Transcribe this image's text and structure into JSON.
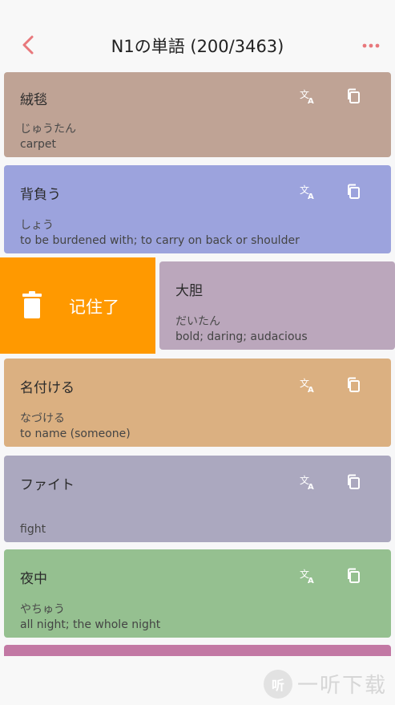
{
  "header": {
    "title": "N1の単語 (200/3463)",
    "back_icon": "chevron-left-icon",
    "more_icon": "more-dots-icon",
    "accent": "#e8787c"
  },
  "cards": [
    {
      "word": "絨毯",
      "reading": "じゅうたん",
      "meaning": "carpet",
      "color": "#bfa395"
    },
    {
      "word": "背負う",
      "reading": "しょう",
      "meaning": "to be burdened with; to carry on back or shoulder",
      "color": "#9ca3dd"
    },
    {
      "word": "大胆",
      "reading": "だいたん",
      "meaning": "bold; daring; audacious",
      "color": "#bba7bc"
    },
    {
      "word": "名付ける",
      "reading": "なづける",
      "meaning": "to name (someone)",
      "color": "#dbb081"
    },
    {
      "word": "ファイト",
      "reading": "",
      "meaning": "fight",
      "color": "#aba8bf"
    },
    {
      "word": "夜中",
      "reading": "やちゅう",
      "meaning": "all night; the whole night",
      "color": "#95c090"
    },
    {
      "color": "#c278a4"
    }
  ],
  "swipe_action": {
    "label": "记住了",
    "icon": "trash-icon",
    "color": "#ff9900"
  },
  "icons": {
    "translate": "translate-icon",
    "copy": "copy-icon"
  },
  "watermark": {
    "logo_text": "听",
    "text": "一听下载"
  }
}
